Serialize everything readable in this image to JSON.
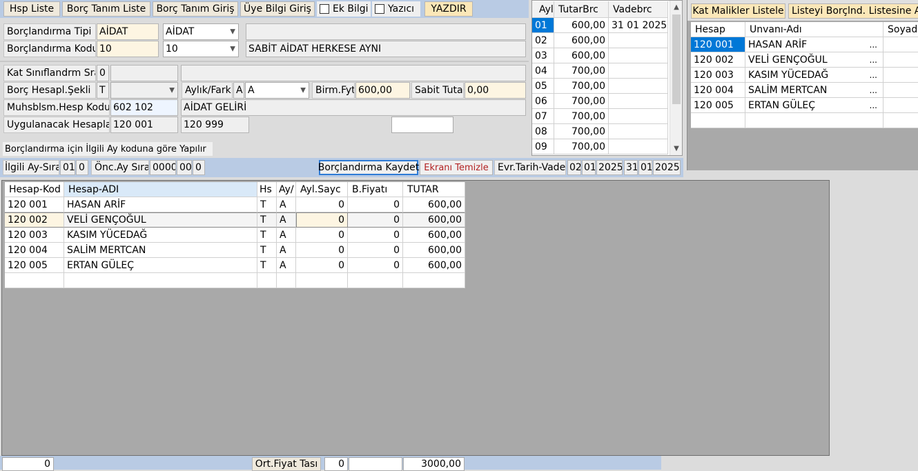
{
  "toolbar": {
    "hsp_liste": "Hsp Liste",
    "borc_tanim_liste": "Borç Tanım Liste",
    "borc_tanim_giris": "Borç Tanım Giriş",
    "uye_bilgi_giris": "Üye Bilgi Giriş",
    "ek_bilgi": "Ek Bilgi",
    "yazici": "Yazıcı",
    "yazdir": "YAZDIR"
  },
  "form": {
    "borclandirma_tipi_label": "Borçlandırma Tipi",
    "borclandirma_tipi_value": "AİDAT",
    "borclandirma_tipi_combo": "AİDAT",
    "borclandirma_kodu_label": "Borçlandırma Kodu",
    "borclandirma_kodu_value": "10",
    "borclandirma_kodu_combo": "10",
    "borclandirma_kodu_desc": "SABİT AİDAT HERKESE AYNI",
    "kat_sinif_label": "Kat Sınıflandrm Sra",
    "kat_sinif_value": "0",
    "borc_hesapl_label": "Borç Hesapl.Şekli",
    "borc_hesapl_value": "T",
    "aylik_fark_label": "Aylık/Fark",
    "aylik_fark_value": "A",
    "aylik_fark_combo": "A",
    "birm_fyt_label": "Birm.Fyt",
    "birm_fyt_value": "600,00",
    "sabit_tutar_label": "Sabit Tutar",
    "sabit_tutar_value": "0,00",
    "muhsblsm_label": "Muhsblsm.Hesp Kodu",
    "muhsblsm_value": "602 102",
    "muhsblsm_desc": "AİDAT GELİRİ",
    "uygulanacak_label": "Uygulanacak Hesaplar",
    "uygulanacak_from": "120 001",
    "uygulanacak_to": "120 999",
    "info_text": "Borçlandırma için İlgili Ay koduna göre Yapılır"
  },
  "schedule": {
    "headers": [
      "Ayl",
      "TutarBrc",
      "Vadebrc"
    ],
    "rows": [
      {
        "ay": "01",
        "tutar": "600,00",
        "vade": "31 01 2025"
      },
      {
        "ay": "02",
        "tutar": "600,00",
        "vade": ""
      },
      {
        "ay": "03",
        "tutar": "600,00",
        "vade": ""
      },
      {
        "ay": "04",
        "tutar": "700,00",
        "vade": ""
      },
      {
        "ay": "05",
        "tutar": "700,00",
        "vade": ""
      },
      {
        "ay": "06",
        "tutar": "700,00",
        "vade": ""
      },
      {
        "ay": "07",
        "tutar": "700,00",
        "vade": ""
      },
      {
        "ay": "08",
        "tutar": "700,00",
        "vade": ""
      },
      {
        "ay": "09",
        "tutar": "700,00",
        "vade": ""
      }
    ]
  },
  "owners": {
    "btn_kat_malikler": "Kat Malikler Listele",
    "btn_listeyi": "Listeyi Borçlnd. Listesine Ak",
    "headers": [
      "Hesap",
      "Unvanı-Adı",
      "Soyad"
    ],
    "rows": [
      {
        "hesap": "120 001",
        "unvan": "HASAN ARİF",
        "dots": "..."
      },
      {
        "hesap": "120 002",
        "unvan": "VELİ GENÇOĞUL",
        "dots": "..."
      },
      {
        "hesap": "120 003",
        "unvan": "KASIM YÜCEDAĞ",
        "dots": "..."
      },
      {
        "hesap": "120 004",
        "unvan": "SALİM MERTCAN",
        "dots": "..."
      },
      {
        "hesap": "120 005",
        "unvan": "ERTAN GÜLEÇ",
        "dots": "..."
      }
    ]
  },
  "period": {
    "ilgili_label": "İlgili Ay-Sıra",
    "ilgili_ay": "01",
    "ilgili_sira": "0",
    "onc_label": "Önc.Ay Sıra",
    "onc_a": "0000",
    "onc_b": "00",
    "onc_c": "0",
    "kaydet": "Borçlandırma Kaydet",
    "temizle": "Ekranı Temizle",
    "evr_label": "Evr.Tarih-Vade",
    "evr_d": "02",
    "evr_m": "01",
    "evr_y": "2025",
    "vade_d": "31",
    "vade_m": "01",
    "vade_y": "2025"
  },
  "main_grid": {
    "headers": [
      "Hesap-Kod",
      "Hesap-ADI",
      "Hs",
      "Ay/",
      "Ayl.Sayc",
      "B.Fiyatı",
      "TUTAR"
    ],
    "rows": [
      {
        "kod": "120 001",
        "adi": "HASAN ARİF",
        "hs": "T",
        "ay": "A",
        "sayc": "0",
        "fiyat": "0",
        "tutar": "600,00"
      },
      {
        "kod": "120 002",
        "adi": "VELİ GENÇOĞUL",
        "hs": "T",
        "ay": "A",
        "sayc": "0",
        "fiyat": "0",
        "tutar": "600,00"
      },
      {
        "kod": "120 003",
        "adi": "KASIM YÜCEDAĞ",
        "hs": "T",
        "ay": "A",
        "sayc": "0",
        "fiyat": "0",
        "tutar": "600,00"
      },
      {
        "kod": "120 004",
        "adi": "SALİM MERTCAN",
        "hs": "T",
        "ay": "A",
        "sayc": "0",
        "fiyat": "0",
        "tutar": "600,00"
      },
      {
        "kod": "120 005",
        "adi": "ERTAN GÜLEÇ",
        "hs": "T",
        "ay": "A",
        "sayc": "0",
        "fiyat": "0",
        "tutar": "600,00"
      }
    ]
  },
  "footer": {
    "left_value": "0",
    "ort_fiyat": "Ort.Fiyat Tası",
    "mid_value": "0",
    "total": "3000,00"
  }
}
